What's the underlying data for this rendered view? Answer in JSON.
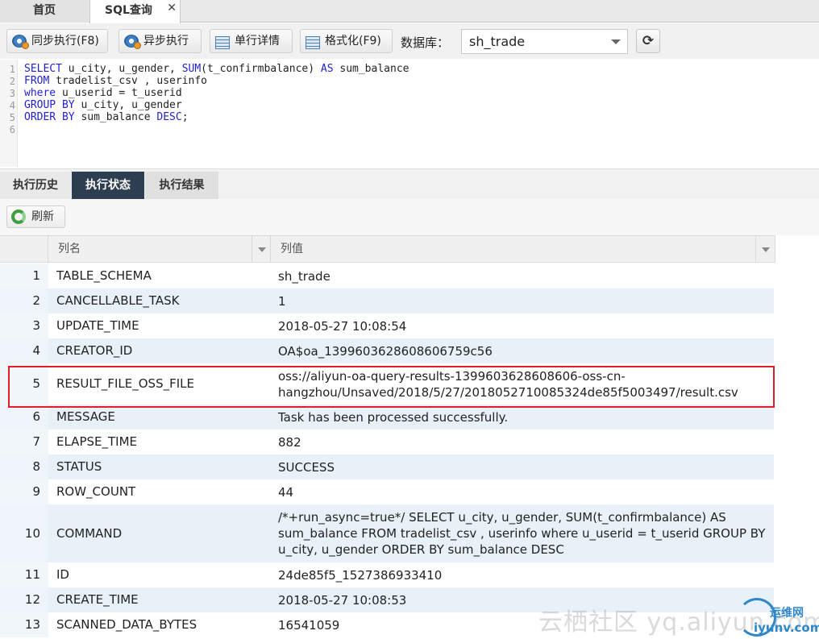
{
  "top_tabs": {
    "home": "首页",
    "sql": "SQL查询",
    "close": "✕"
  },
  "toolbar": {
    "sync_exec": "同步执行(F8)",
    "async_exec": "异步执行",
    "row_detail": "单行详情",
    "format": "格式化(F9)",
    "db_label": "数据库：",
    "db_value": "sh_trade",
    "refresh_icon": "⟳"
  },
  "editor": {
    "line_numbers": [
      "1",
      "2",
      "3",
      "4",
      "5",
      "6"
    ],
    "lines": [
      [
        [
          "kw",
          "SELECT"
        ],
        [
          "t",
          " u_city, u_gender, "
        ],
        [
          "kw",
          "SUM"
        ],
        [
          "t",
          "(t_confirmbalance) "
        ],
        [
          "kw",
          "AS"
        ],
        [
          "t",
          " sum_balance"
        ]
      ],
      [
        [
          "kw",
          "FROM"
        ],
        [
          "t",
          " tradelist_csv , userinfo"
        ]
      ],
      [
        [
          "kw",
          "where"
        ],
        [
          "t",
          " u_userid = t_userid"
        ]
      ],
      [
        [
          "kw",
          "GROUP BY"
        ],
        [
          "t",
          " u_city, u_gender"
        ]
      ],
      [
        [
          "kw",
          "ORDER BY"
        ],
        [
          "t",
          " sum_balance "
        ],
        [
          "kw",
          "DESC"
        ],
        [
          "t",
          ";"
        ]
      ],
      [
        [
          "t",
          ""
        ]
      ]
    ]
  },
  "bottom_tabs": {
    "history": "执行历史",
    "status": "执行状态",
    "result": "执行结果"
  },
  "refresh": {
    "label": "刷新"
  },
  "grid": {
    "col_name": "列名",
    "col_value": "列值",
    "rows": [
      {
        "n": "1",
        "name": "TABLE_SCHEMA",
        "value": "sh_trade"
      },
      {
        "n": "2",
        "name": "CANCELLABLE_TASK",
        "value": "1"
      },
      {
        "n": "3",
        "name": "UPDATE_TIME",
        "value": "2018-05-27 10:08:54"
      },
      {
        "n": "4",
        "name": "CREATOR_ID",
        "value": "OA$oa_1399603628608606759c56"
      },
      {
        "n": "5",
        "name": "RESULT_FILE_OSS_FILE",
        "value": "oss://aliyun-oa-query-results-1399603628608606-oss-cn-hangzhou/Unsaved/2018/5/27/2018052710085324de85f5003497/result.csv"
      },
      {
        "n": "6",
        "name": "MESSAGE",
        "value": "Task has been processed successfully."
      },
      {
        "n": "7",
        "name": "ELAPSE_TIME",
        "value": "882"
      },
      {
        "n": "8",
        "name": "STATUS",
        "value": "SUCCESS"
      },
      {
        "n": "9",
        "name": "ROW_COUNT",
        "value": "44"
      },
      {
        "n": "10",
        "name": "COMMAND",
        "value": "/*+run_async=true*/ SELECT u_city, u_gender, SUM(t_confirmbalance) AS sum_balance FROM tradelist_csv , userinfo where u_userid = t_userid GROUP BY u_city, u_gender ORDER BY sum_balance DESC"
      },
      {
        "n": "11",
        "name": "ID",
        "value": "24de85f5_1527386933410"
      },
      {
        "n": "12",
        "name": "CREATE_TIME",
        "value": "2018-05-27 10:08:53"
      },
      {
        "n": "13",
        "name": "SCANNED_DATA_BYTES",
        "value": "16541059"
      }
    ]
  },
  "watermark": {
    "text": "云栖社区 yq.aliyun.com",
    "logo_top": "运维网",
    "logo_bottom": "iyunv.com"
  }
}
